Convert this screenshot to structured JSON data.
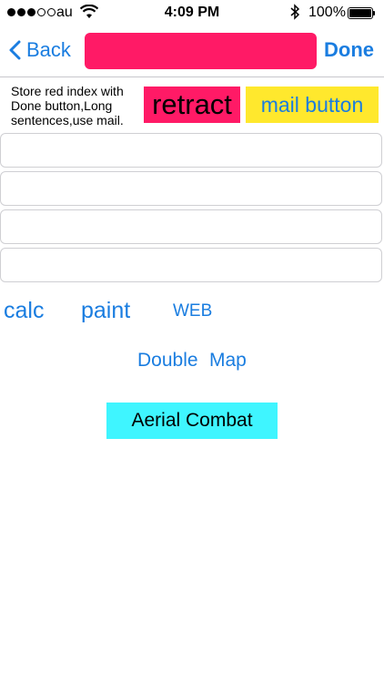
{
  "status_bar": {
    "carrier": "au",
    "time": "4:09 PM",
    "battery": "100%"
  },
  "nav": {
    "back_label": "Back",
    "done_label": "Done"
  },
  "colors": {
    "accent": "#1a7de0",
    "title_field": "#ff1a66",
    "retract_bg": "#ff1a66",
    "mail_bg": "#ffe82d",
    "aerial_bg": "#3ff5ff"
  },
  "note": "Store red index with Done button,Long sentences,use mail.",
  "buttons": {
    "retract": "retract",
    "mail": "mail button",
    "calc": "calc",
    "paint": "paint",
    "web": "WEB",
    "double": "Double",
    "map": "Map",
    "aerial": "Aerial Combat"
  },
  "fields": [
    "",
    "",
    "",
    ""
  ]
}
